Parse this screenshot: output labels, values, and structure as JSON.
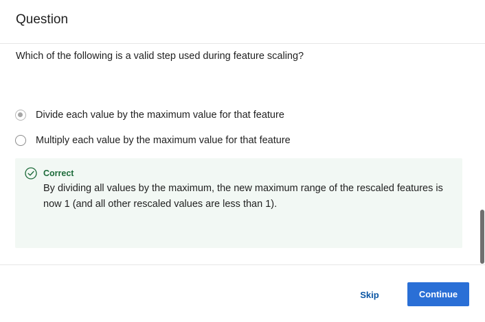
{
  "header": {
    "title": "Question"
  },
  "question": {
    "text": "Which of the following is a valid step used during feature scaling?"
  },
  "options": [
    {
      "label": "Divide each value by the maximum value for that feature",
      "selected": true
    },
    {
      "label": "Multiply each value by the maximum value for that feature",
      "selected": false
    }
  ],
  "feedback": {
    "status": "Correct",
    "icon": "check-circle-icon",
    "body": "By dividing all values by the maximum, the new maximum range of the rescaled features is now 1 (and all other rescaled values are less than 1).",
    "background_color": "#f2f8f4",
    "status_color": "#1d6b3a"
  },
  "footer": {
    "skip_label": "Skip",
    "continue_label": "Continue",
    "accent_color": "#2a6fd6"
  }
}
